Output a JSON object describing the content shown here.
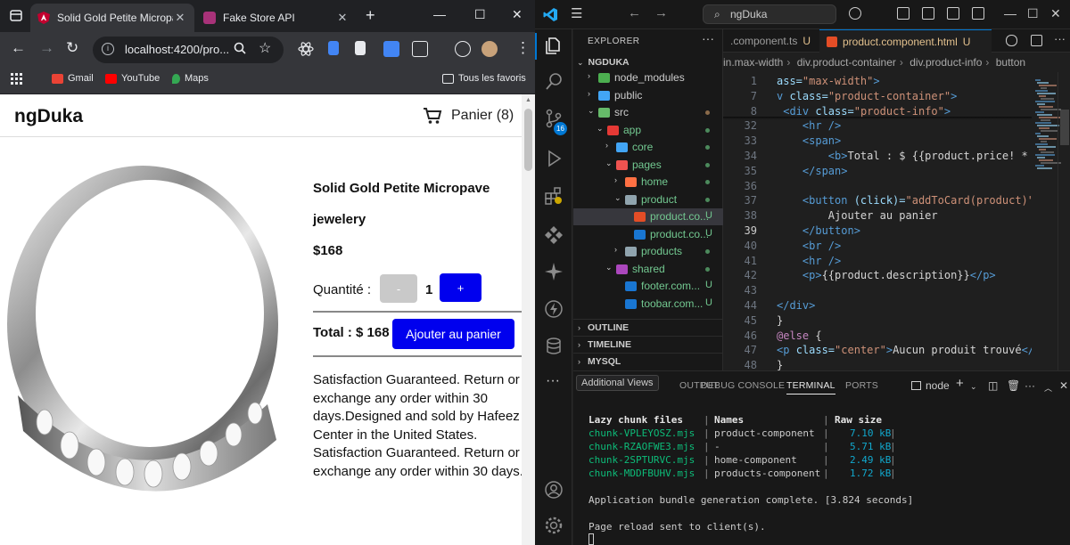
{
  "browser": {
    "tabs": [
      {
        "title": "Solid Gold Petite Micropave",
        "active": true
      },
      {
        "title": "Fake Store API",
        "active": false
      }
    ],
    "url": "localhost:4200/pro...",
    "bookmarks": [
      "Gmail",
      "YouTube",
      "Maps"
    ],
    "all_bookmarks_label": "Tous les favoris"
  },
  "store": {
    "brand": "ngDuka",
    "cart_label": "Panier (8)",
    "product": {
      "title": "Solid Gold Petite Micropave",
      "category": "jewelery",
      "price": "$168",
      "quantity_label": "Quantité :",
      "minus_label": "-",
      "quantity": "1",
      "plus_label": "+",
      "total": "Total : $ 168",
      "add_to_cart_label": "Ajouter au panier",
      "description": "Satisfaction Guaranteed. Return or exchange any order within 30 days.Designed and sold by Hafeez Center in the United States. Satisfaction Guaranteed. Return or exchange any order within 30 days."
    }
  },
  "vscode": {
    "search_text": "ngDuka",
    "explorer_title": "EXPLORER",
    "root_folder": "NGDUKA",
    "tree": [
      {
        "name": "node_modules",
        "indent": 0,
        "chev": "›",
        "icon": "#4caf50",
        "status": ""
      },
      {
        "name": "public",
        "indent": 0,
        "chev": "›",
        "icon": "#42a5f5",
        "status": ""
      },
      {
        "name": "src",
        "indent": 0,
        "chev": "⌄",
        "icon": "#66bb6a",
        "status": "dot-brown"
      },
      {
        "name": "app",
        "indent": 1,
        "chev": "⌄",
        "icon": "#e53935",
        "status": "dot-green",
        "green": true
      },
      {
        "name": "core",
        "indent": 2,
        "chev": "›",
        "icon": "#42a5f5",
        "status": "dot-green",
        "green": true
      },
      {
        "name": "pages",
        "indent": 2,
        "chev": "⌄",
        "icon": "#ef5350",
        "status": "dot-green",
        "green": true
      },
      {
        "name": "home",
        "indent": 3,
        "chev": "›",
        "icon": "#ff7043",
        "status": "dot-green",
        "green": true
      },
      {
        "name": "product",
        "indent": 3,
        "chev": "⌄",
        "icon": "#90a4ae",
        "status": "dot-green",
        "green": true
      },
      {
        "name": "product.co...",
        "indent": 4,
        "chev": "",
        "icon": "#e44d26",
        "status": "U",
        "green": true,
        "selected": true
      },
      {
        "name": "product.co...",
        "indent": 4,
        "chev": "",
        "icon": "#1976d2",
        "status": "U",
        "green": true
      },
      {
        "name": "products",
        "indent": 3,
        "chev": "›",
        "icon": "#90a4ae",
        "status": "dot-green",
        "green": true
      },
      {
        "name": "shared",
        "indent": 2,
        "chev": "⌄",
        "icon": "#ab47bc",
        "status": "dot-green",
        "green": true
      },
      {
        "name": "footer.com...",
        "indent": 3,
        "chev": "",
        "icon": "#1976d2",
        "status": "U",
        "green": true
      },
      {
        "name": "toobar.com...",
        "indent": 3,
        "chev": "",
        "icon": "#1976d2",
        "status": "U",
        "green": true
      }
    ],
    "sections": [
      "OUTLINE",
      "TIMELINE",
      "MYSQL"
    ],
    "editor_tabs": [
      {
        "title": ".component.ts",
        "status": "U"
      },
      {
        "title": "product.component.html",
        "status": "U"
      }
    ],
    "breadcrumbs": [
      "in.max-width",
      "div.product-container",
      "div.product-info",
      "button"
    ],
    "code_lines": [
      {
        "n": "1",
        "t": [
          [
            "attr",
            "ass="
          ],
          [
            "str",
            "\"max-width\""
          ],
          [
            "tag",
            ">"
          ]
        ]
      },
      {
        "n": "7",
        "t": [
          [
            "tag",
            "v "
          ],
          [
            "attr",
            "class="
          ],
          [
            "str",
            "\"product-container\""
          ],
          [
            "tag",
            ">"
          ]
        ]
      },
      {
        "n": "8",
        "t": [
          [
            "tag",
            " <div "
          ],
          [
            "attr",
            "class="
          ],
          [
            "str",
            "\"product-info\""
          ],
          [
            "tag",
            ">"
          ]
        ]
      },
      {
        "n": "32",
        "t": [
          [
            "tag",
            "    <hr />"
          ]
        ]
      },
      {
        "n": "33",
        "t": [
          [
            "tag",
            "    <span>"
          ]
        ]
      },
      {
        "n": "34",
        "t": [
          [
            "tag",
            "        <b>"
          ],
          [
            "txt",
            "Total : $ {{product.price! *"
          ]
        ]
      },
      {
        "n": "35",
        "t": [
          [
            "tag",
            "    </span>"
          ]
        ]
      },
      {
        "n": "36",
        "t": [
          [
            "txt",
            ""
          ]
        ]
      },
      {
        "n": "37",
        "t": [
          [
            "tag",
            "    <button "
          ],
          [
            "attr",
            "(click)="
          ],
          [
            "str",
            "\"addToCard(product)\""
          ]
        ]
      },
      {
        "n": "38",
        "t": [
          [
            "txt",
            "        Ajouter au panier"
          ]
        ]
      },
      {
        "n": "39",
        "t": [
          [
            "tag",
            "    </button>"
          ]
        ]
      },
      {
        "n": "40",
        "t": [
          [
            "tag",
            "    <br />"
          ]
        ]
      },
      {
        "n": "41",
        "t": [
          [
            "tag",
            "    <hr />"
          ]
        ]
      },
      {
        "n": "42",
        "t": [
          [
            "tag",
            "    <p>"
          ],
          [
            "txt",
            "{{product.description}}"
          ],
          [
            "tag",
            "</p>"
          ]
        ]
      },
      {
        "n": "43",
        "t": [
          [
            "txt",
            ""
          ]
        ]
      },
      {
        "n": "44",
        "t": [
          [
            "tag",
            "</div>"
          ]
        ]
      },
      {
        "n": "45",
        "t": [
          [
            "txt",
            "}"
          ]
        ]
      },
      {
        "n": "46",
        "t": [
          [
            "at",
            "@else"
          ],
          [
            "txt",
            " {"
          ]
        ]
      },
      {
        "n": "47",
        "t": [
          [
            "tag",
            "<p "
          ],
          [
            "attr",
            "class="
          ],
          [
            "str",
            "\"center\""
          ],
          [
            "tag",
            ">"
          ],
          [
            "txt",
            "Aucun produit trouvé"
          ],
          [
            "tag",
            "</"
          ]
        ]
      },
      {
        "n": "48",
        "t": [
          [
            "txt",
            "}"
          ]
        ]
      }
    ],
    "panel_tabs": [
      "OUTPUT",
      "DEBUG CONSOLE",
      "TERMINAL",
      "PORTS"
    ],
    "tooltip": "Additional Views",
    "terminal_profile": "node",
    "terminal": {
      "headers": [
        "Lazy chunk files",
        "Names",
        "Raw size"
      ],
      "rows": [
        {
          "file": "chunk-VPLEYOSZ.mjs",
          "name": "product-component",
          "size": "7.10 kB"
        },
        {
          "file": "chunk-RZAOFWE3.mjs",
          "name": "-",
          "size": "5.71 kB"
        },
        {
          "file": "chunk-2SPTURVC.mjs",
          "name": "home-component",
          "size": "2.49 kB"
        },
        {
          "file": "chunk-MDDFBUHV.mjs",
          "name": "products-component",
          "size": "1.72 kB"
        }
      ],
      "complete": "Application bundle generation complete. [3.824 seconds]",
      "reload": "Page reload sent to client(s)."
    }
  }
}
